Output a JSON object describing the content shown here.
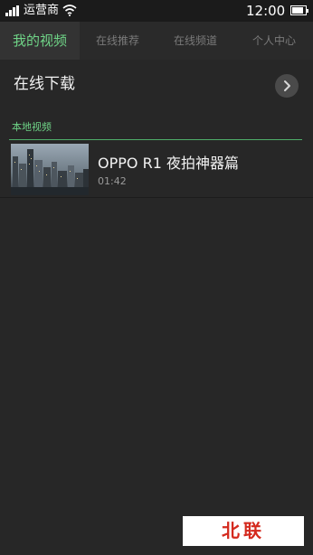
{
  "status_bar": {
    "carrier": "运营商",
    "time": "12:00",
    "battery_level": 0.85
  },
  "tabs": [
    {
      "label": "我的视频",
      "active": true
    },
    {
      "label": "在线推荐",
      "active": false
    },
    {
      "label": "在线频道",
      "active": false
    },
    {
      "label": "个人中心",
      "active": false
    }
  ],
  "online_download": {
    "label": "在线下载"
  },
  "local_videos": {
    "section_title": "本地视频",
    "items": [
      {
        "title": "OPPO R1 夜拍神器篇",
        "duration": "01:42"
      }
    ]
  },
  "watermark": {
    "text": "北联"
  },
  "colors": {
    "accent_green": "#6fd487",
    "background": "#272727",
    "tab_bar": "#2a2a2a",
    "watermark_text": "#d42a1e"
  }
}
